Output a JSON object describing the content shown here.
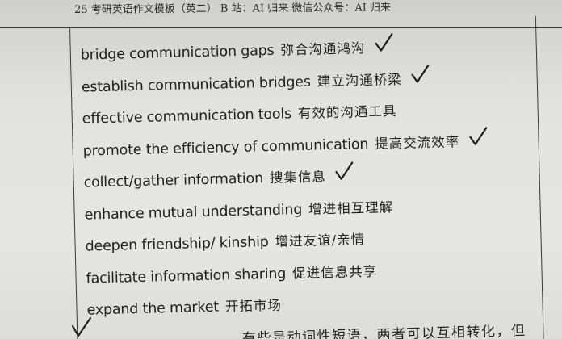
{
  "header": {
    "text": "25 考研英语作文模板（英二） B 站：AI 归来 微信公众号：AI 归来"
  },
  "phrases": [
    {
      "en": "bridge communication gaps",
      "zh": "弥合沟通鸿沟",
      "checked": true
    },
    {
      "en": "establish communication bridges",
      "zh": "建立沟通桥梁",
      "checked": true
    },
    {
      "en": "effective communication tools",
      "zh": "有效的沟通工具",
      "checked": false
    },
    {
      "en": "promote the efficiency of communication",
      "zh": "提高交流效率",
      "checked": true
    },
    {
      "en": "collect/gather information",
      "zh": "搜集信息",
      "checked": true
    },
    {
      "en": "enhance mutual understanding",
      "zh": "增进相互理解",
      "checked": false
    },
    {
      "en": "deepen friendship/ kinship",
      "zh": "增进友谊/亲情",
      "checked": false
    },
    {
      "en": "facilitate information sharing",
      "zh": "促进信息共享",
      "checked": false
    },
    {
      "en": "expand the market",
      "zh": "开拓市场",
      "checked": false
    }
  ],
  "footer_fragment": "有些是动词性短语，两者可以互相转化，但"
}
